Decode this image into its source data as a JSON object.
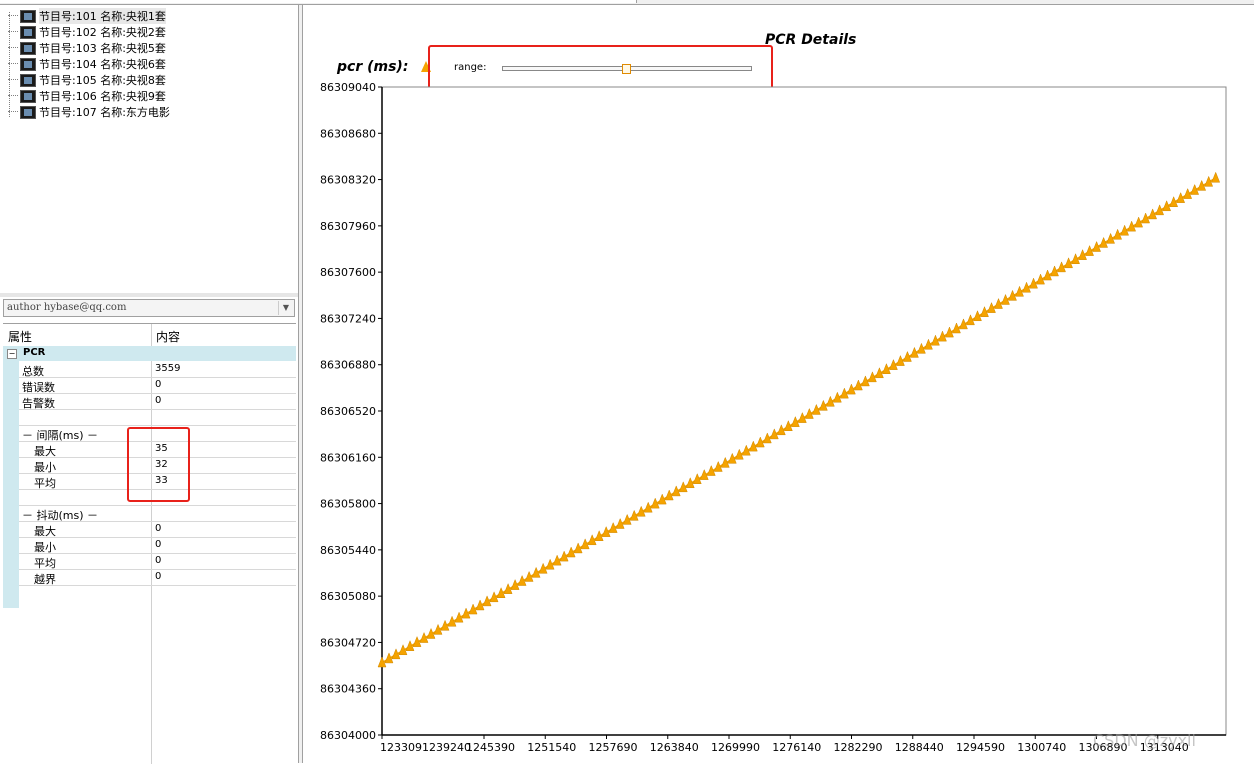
{
  "tree": {
    "items": [
      {
        "label": "节目号:101 名称:央视1套"
      },
      {
        "label": "节目号:102 名称:央视2套"
      },
      {
        "label": "节目号:103 名称:央视5套"
      },
      {
        "label": "节目号:104 名称:央视6套"
      },
      {
        "label": "节目号:105 名称:央视8套"
      },
      {
        "label": "节目号:106 名称:央视9套"
      },
      {
        "label": "节目号:107 名称:东方电影"
      }
    ]
  },
  "combo": {
    "value": "author hybase@qq.com"
  },
  "grid": {
    "headers": {
      "property": "属性",
      "content": "内容"
    },
    "category": "PCR",
    "rows": [
      {
        "key": "总数",
        "value": "3559"
      },
      {
        "key": "错误数",
        "value": "0"
      },
      {
        "key": "告警数",
        "value": "0"
      },
      {
        "key": "",
        "value": ""
      },
      {
        "key": "－ 间隔(ms) －",
        "value": ""
      },
      {
        "key": "最大",
        "value": "35"
      },
      {
        "key": "最小",
        "value": "32"
      },
      {
        "key": "平均",
        "value": "33"
      },
      {
        "key": "",
        "value": ""
      },
      {
        "key": "－ 抖动(ms) －",
        "value": ""
      },
      {
        "key": "最大",
        "value": "0"
      },
      {
        "key": "最小",
        "value": "0"
      },
      {
        "key": "平均",
        "value": "0"
      },
      {
        "key": "越界",
        "value": "0"
      }
    ]
  },
  "chart_header": {
    "title": "PCR Details",
    "series_label": "pcr (ms):",
    "range_label": "range:",
    "range_value": 0.5
  },
  "colors": {
    "series": "#f5a300",
    "highlight": "#e8211a"
  },
  "watermark": "CSDN @zyxll",
  "chart_data": {
    "type": "scatter",
    "title": "PCR Details",
    "ylabel": "pcr (ms):",
    "xlabel": "",
    "x_tick_labels": [
      "1233091239240",
      "1245390",
      "1251540",
      "1257690",
      "1263840",
      "1269990",
      "1276140",
      "1282290",
      "1288440",
      "1294590",
      "1300740",
      "1306890",
      "1313040"
    ],
    "y_ticks": [
      86304000,
      86304360,
      86304720,
      86305080,
      86305440,
      86305800,
      86306160,
      86306520,
      86306880,
      86307240,
      86307600,
      86307960,
      86308320,
      86308680,
      86309040
    ],
    "ylim": [
      86304000,
      86309040
    ],
    "xlim": [
      1233091,
      1315000
    ],
    "series": [
      {
        "points_start": [
          1233091,
          86304560
        ],
        "points_end": [
          1314000,
          86308330
        ],
        "count": 120,
        "marker": "triangle"
      }
    ],
    "legend": "top-left",
    "grid": false
  }
}
